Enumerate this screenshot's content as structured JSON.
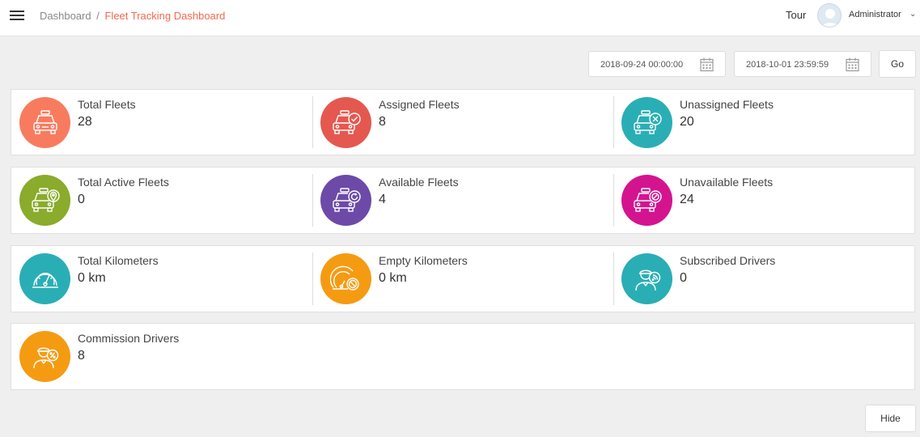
{
  "breadcrumb": {
    "home": "Dashboard",
    "separator": "/",
    "current": "Fleet Tracking Dashboard"
  },
  "header": {
    "tour": "Tour",
    "user": "Administrator"
  },
  "filters": {
    "start_date": "2018-09-24 00:00:00",
    "end_date": "2018-10-01 23:59:59",
    "go_label": "Go"
  },
  "cards": [
    {
      "label": "Total Fleets",
      "value": "28",
      "color": "#f97b5f",
      "icon": "car-icon"
    },
    {
      "label": "Assigned Fleets",
      "value": "8",
      "color": "#e5584f",
      "icon": "car-check-icon"
    },
    {
      "label": "Unassigned Fleets",
      "value": "20",
      "color": "#2aaeb5",
      "icon": "car-cross-icon"
    },
    {
      "label": "Total Active Fleets",
      "value": "0",
      "color": "#8aab2c",
      "icon": "car-pin-icon"
    },
    {
      "label": "Available Fleets",
      "value": "4",
      "color": "#6d4aa8",
      "icon": "car-refresh-icon"
    },
    {
      "label": "Unavailable Fleets",
      "value": "24",
      "color": "#d4148f",
      "icon": "car-blocked-icon"
    },
    {
      "label": "Total Kilometers",
      "value": "0 km",
      "color": "#2aaeb5",
      "icon": "speedometer-icon"
    },
    {
      "label": "Empty Kilometers",
      "value": "0 km",
      "color": "#f59b12",
      "icon": "speedometer-blocked-icon"
    },
    {
      "label": "Subscribed Drivers",
      "value": "0",
      "color": "#2aaeb5",
      "icon": "driver-signal-icon"
    },
    {
      "label": "Commission Drivers",
      "value": "8",
      "color": "#f59b12",
      "icon": "driver-percent-icon"
    }
  ],
  "hide_label": "Hide"
}
